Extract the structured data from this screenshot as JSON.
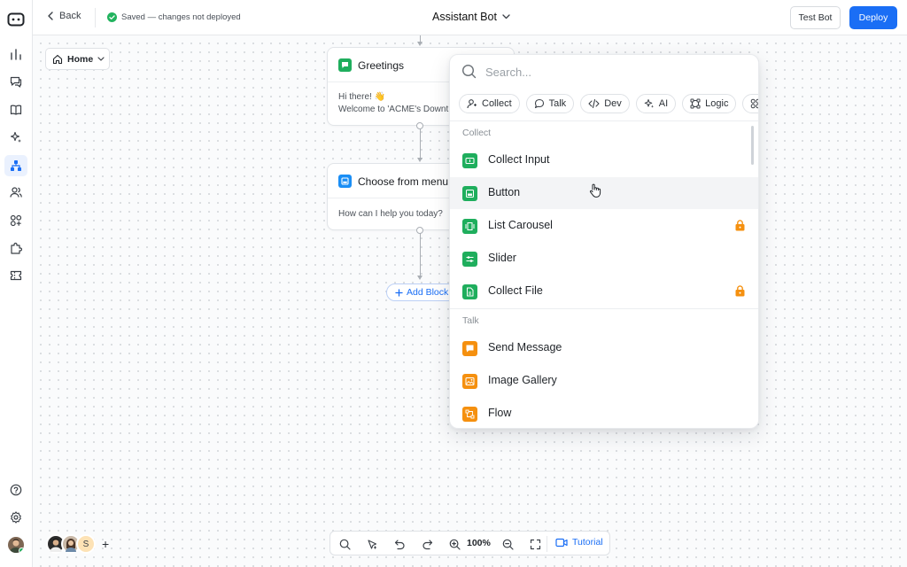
{
  "topbar": {
    "back_label": "Back",
    "saved_status": "Saved — changes not deployed",
    "bot_name": "Assistant Bot",
    "test_label": "Test Bot",
    "deploy_label": "Deploy"
  },
  "canvas": {
    "home_label": "Home",
    "nodes": [
      {
        "title": "Greetings",
        "line1": "Hi there! 👋",
        "line2": "Welcome to 'ACME's Downt",
        "color": "#1fae5d"
      },
      {
        "title": "Choose from menu",
        "line1": "How can I help you today?",
        "color": "#1a8ef5"
      }
    ],
    "add_block_label": "Add Block"
  },
  "panel": {
    "search_placeholder": "Search...",
    "chips": [
      {
        "label": "Collect",
        "icon": "user-icon"
      },
      {
        "label": "Talk",
        "icon": "chat-bubble-icon"
      },
      {
        "label": "Dev",
        "icon": "code-icon"
      },
      {
        "label": "AI",
        "icon": "sparkle-icon"
      },
      {
        "label": "Logic",
        "icon": "logic-icon"
      }
    ],
    "sections": [
      {
        "title": "Collect",
        "items": [
          {
            "label": "Collect Input",
            "color": "#1fae5d",
            "locked": false
          },
          {
            "label": "Button",
            "color": "#1fae5d",
            "locked": false
          },
          {
            "label": "List Carousel",
            "color": "#1fae5d",
            "locked": true
          },
          {
            "label": "Slider",
            "color": "#1fae5d",
            "locked": false
          },
          {
            "label": "Collect File",
            "color": "#1fae5d",
            "locked": true
          }
        ]
      },
      {
        "title": "Talk",
        "items": [
          {
            "label": "Send Message",
            "color": "#f5900f",
            "locked": false
          },
          {
            "label": "Image Gallery",
            "color": "#f5900f",
            "locked": false
          },
          {
            "label": "Flow",
            "color": "#f5900f",
            "locked": false
          }
        ]
      }
    ]
  },
  "toolbar": {
    "zoom": "100%",
    "tutorial_label": "Tutorial"
  },
  "collaborators": {
    "initial": "S"
  },
  "colors": {
    "accent": "#1a6ef5",
    "collect": "#1fae5d",
    "talk": "#f5900f",
    "lock": "#f5900f"
  }
}
